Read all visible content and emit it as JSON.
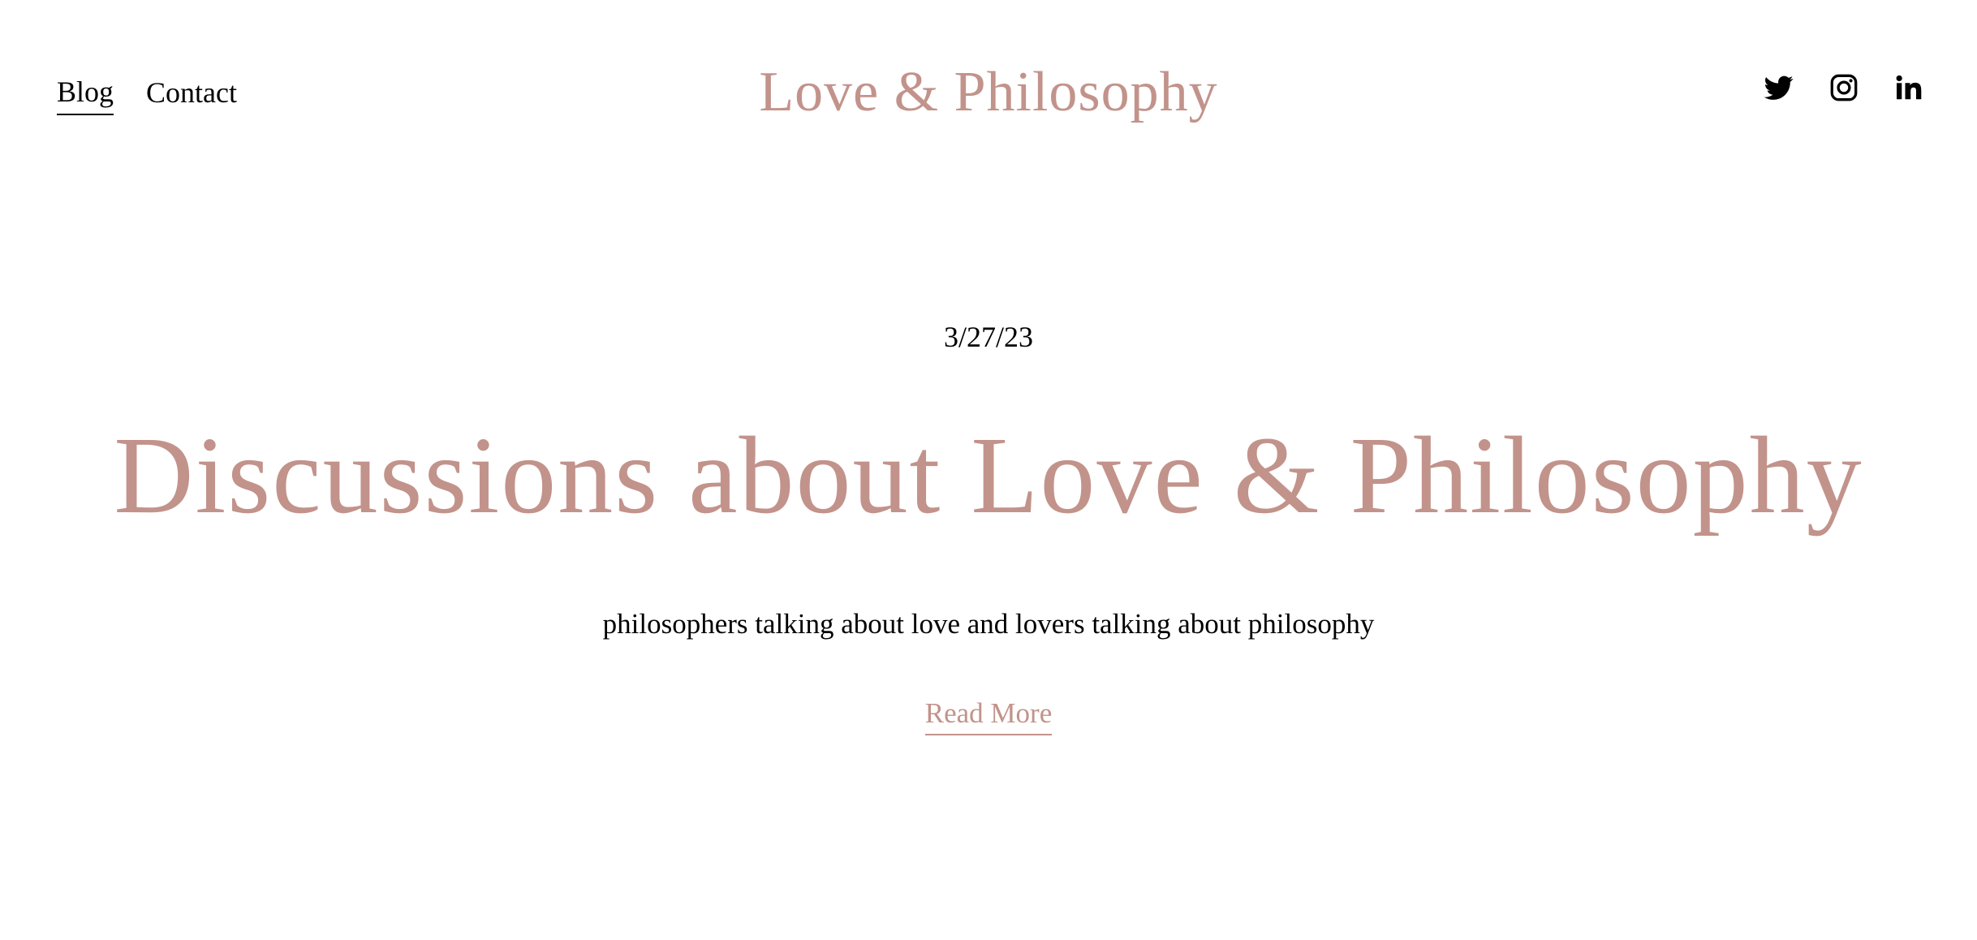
{
  "header": {
    "nav": [
      {
        "label": "Blog",
        "active": true
      },
      {
        "label": "Contact",
        "active": false
      }
    ],
    "site_title": "Love & Philosophy",
    "social": [
      {
        "icon": "twitter-icon"
      },
      {
        "icon": "instagram-icon"
      },
      {
        "icon": "linkedin-icon"
      }
    ]
  },
  "hero": {
    "date": "3/27/23",
    "headline": "Discussions about Love & Philosophy",
    "subtitle": "philosophers talking about love and lovers talking about philosophy",
    "read_more_label": "Read More"
  },
  "colors": {
    "accent": "#c2938b",
    "text": "#000000",
    "background": "#ffffff"
  }
}
